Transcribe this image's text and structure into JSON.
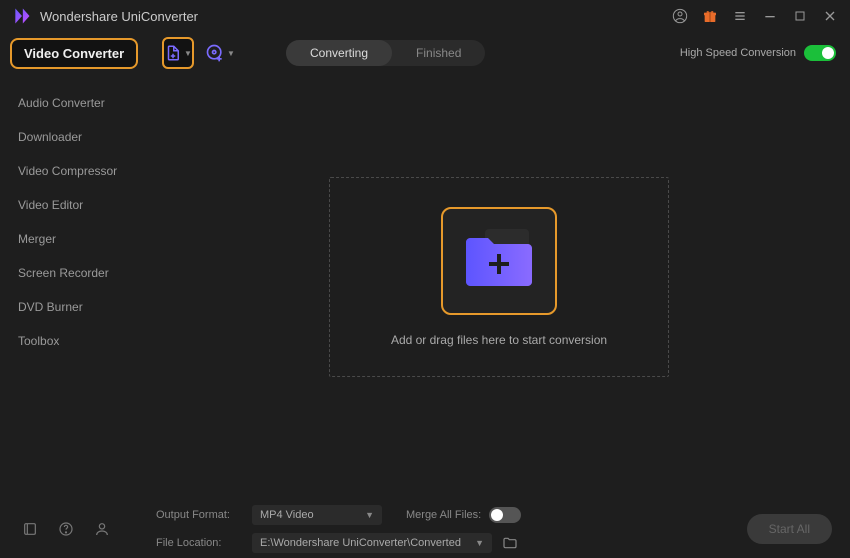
{
  "app": {
    "title": "Wondershare UniConverter"
  },
  "sidebar": {
    "active": "Video Converter",
    "items": [
      {
        "label": "Audio Converter"
      },
      {
        "label": "Downloader"
      },
      {
        "label": "Video Compressor"
      },
      {
        "label": "Video Editor"
      },
      {
        "label": "Merger"
      },
      {
        "label": "Screen Recorder"
      },
      {
        "label": "DVD Burner"
      },
      {
        "label": "Toolbox"
      }
    ]
  },
  "tabs": {
    "converting": "Converting",
    "finished": "Finished"
  },
  "high_speed": {
    "label": "High Speed Conversion",
    "on": true
  },
  "drop": {
    "text": "Add or drag files here to start conversion"
  },
  "bottom": {
    "output_format_label": "Output Format:",
    "output_format_value": "MP4 Video",
    "file_location_label": "File Location:",
    "file_location_value": "E:\\Wondershare UniConverter\\Converted",
    "merge_label": "Merge All Files:",
    "start_label": "Start All"
  }
}
